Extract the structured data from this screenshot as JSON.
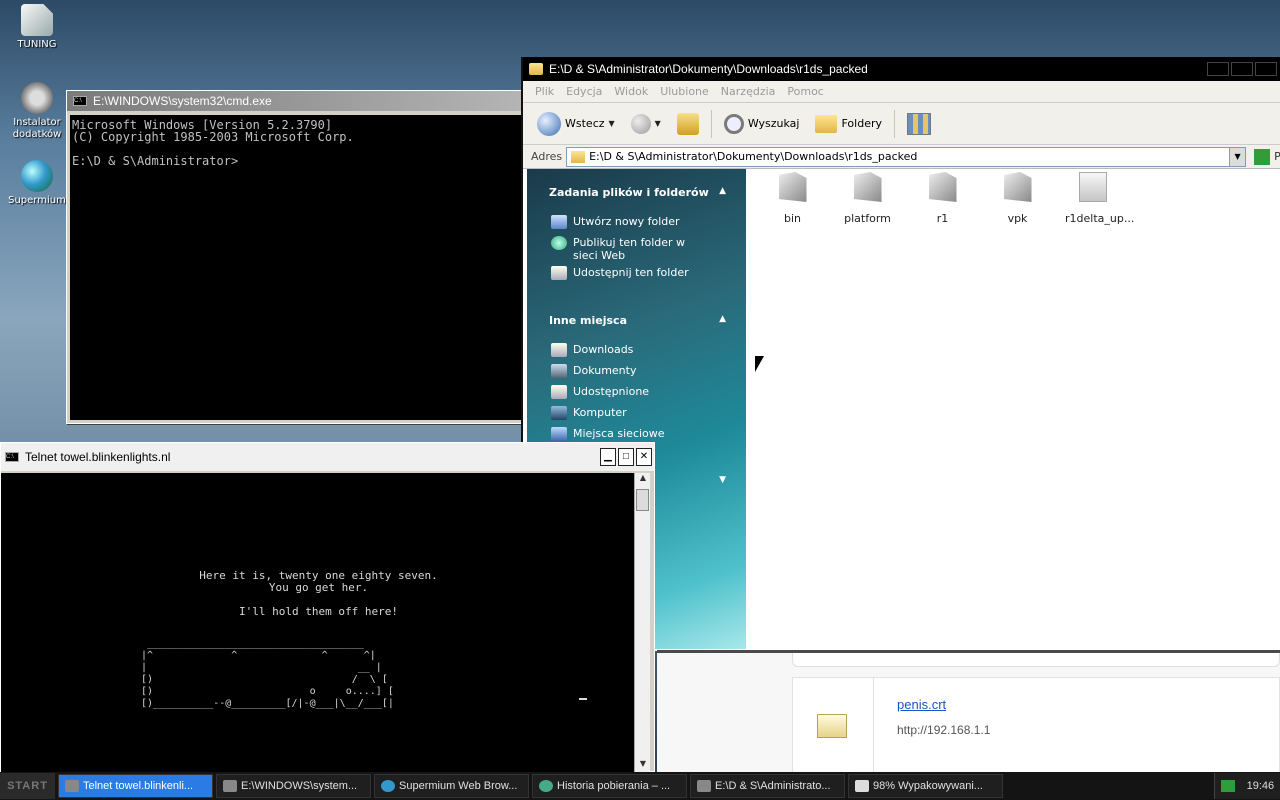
{
  "desktop": {
    "icons": [
      {
        "label": "TUNING"
      },
      {
        "label": "Instalator dodatków"
      },
      {
        "label": "Supermium"
      }
    ]
  },
  "cmd": {
    "title": "E:\\WINDOWS\\system32\\cmd.exe",
    "lines": [
      "Microsoft Windows [Version 5.2.3790]",
      "(C) Copyright 1985-2003 Microsoft Corp.",
      "",
      "E:\\D & S\\Administrator>"
    ]
  },
  "explorer": {
    "title": "E:\\D & S\\Administrator\\Dokumenty\\Downloads\\r1ds_packed",
    "menu": [
      "Plik",
      "Edycja",
      "Widok",
      "Ulubione",
      "Narzędzia",
      "Pomoc"
    ],
    "toolbar": {
      "back": "Wstecz",
      "search": "Wyszukaj",
      "folders": "Foldery"
    },
    "address_label": "Adres",
    "address": "E:\\D & S\\Administrator\\Dokumenty\\Downloads\\r1ds_packed",
    "go_label": "P",
    "tasks": {
      "header": "Zadania plików i folderów",
      "items": [
        "Utwórz nowy folder",
        "Publikuj ten folder w sieci Web",
        "Udostępnij ten folder"
      ]
    },
    "places": {
      "header": "Inne miejsca",
      "items": [
        "Downloads",
        "Dokumenty",
        "Udostępnione",
        "Komputer",
        "Miejsca sieciowe"
      ]
    },
    "files": [
      "bin",
      "platform",
      "r1",
      "vpk",
      "r1delta_up..."
    ]
  },
  "download": {
    "filename": "penis.crt",
    "url": "http://192.168.1.1"
  },
  "telnet": {
    "title": "Telnet towel.blinkenlights.nl",
    "lines": [
      "Here it is, twenty one eighty seven.",
      "You go get her.",
      "I'll hold them off here!"
    ],
    "art": " ____________________________________\n|^             ^              ^      ^|\n|                                   __ |\n[)                                 /  \\ [\n[)                          o     o....] [\n[)__________--@_________[/|-@___|\\__/___[|"
  },
  "taskbar": {
    "start": "START",
    "tasks": [
      {
        "label": "Telnet towel.blinkenli...",
        "active": true
      },
      {
        "label": "E:\\WINDOWS\\system...",
        "active": false
      },
      {
        "label": "Supermium Web Brow...",
        "active": false
      },
      {
        "label": "Historia pobierania – ...",
        "active": false
      },
      {
        "label": "E:\\D & S\\Administrato...",
        "active": false
      },
      {
        "label": "98% Wypakowywani...",
        "active": false
      }
    ],
    "clock": "19:46"
  }
}
